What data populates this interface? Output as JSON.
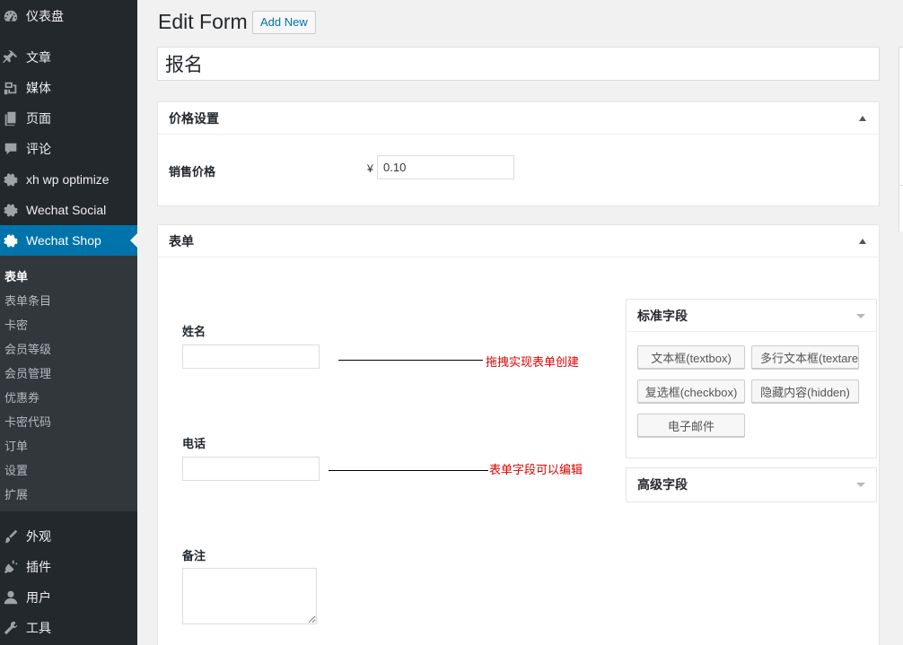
{
  "sidebar": {
    "items": [
      {
        "label": "仪表盘",
        "icon": "dashboard-icon"
      },
      {
        "label": "文章",
        "icon": "pin-icon"
      },
      {
        "label": "媒体",
        "icon": "media-icon"
      },
      {
        "label": "页面",
        "icon": "page-icon"
      },
      {
        "label": "评论",
        "icon": "comment-icon"
      },
      {
        "label": "xh wp optimize",
        "icon": "gear-icon"
      },
      {
        "label": "Wechat Social",
        "icon": "gear-icon"
      },
      {
        "label": "Wechat Shop",
        "icon": "gear-icon"
      }
    ],
    "submenu": [
      "表单",
      "表单条目",
      "卡密",
      "会员等级",
      "会员管理",
      "优惠券",
      "卡密代码",
      "订单",
      "设置",
      "扩展"
    ],
    "bottom_items": [
      {
        "label": "外观",
        "icon": "brush-icon"
      },
      {
        "label": "插件",
        "icon": "plugin-icon"
      },
      {
        "label": "用户",
        "icon": "user-icon"
      },
      {
        "label": "工具",
        "icon": "wrench-icon"
      }
    ]
  },
  "header": {
    "title": "Edit Form",
    "add_new": "Add New"
  },
  "title_value": "报名",
  "price_box": {
    "title": "价格设置",
    "label": "销售价格",
    "currency": "¥",
    "value": "0.10"
  },
  "form_box": {
    "title": "表单",
    "fields": [
      {
        "label": "姓名"
      },
      {
        "label": "电话"
      },
      {
        "label": "备注"
      }
    ],
    "annotations": [
      "拖拽实现表单创建",
      "表单字段可以编辑"
    ]
  },
  "standard_fields": {
    "title": "标准字段",
    "buttons": [
      "文本框(textbox)",
      "多行文本框(textarea)",
      "复选框(checkbox)",
      "隐藏内容(hidden)",
      "电子邮件"
    ]
  },
  "advanced_fields": {
    "title": "高级字段"
  }
}
